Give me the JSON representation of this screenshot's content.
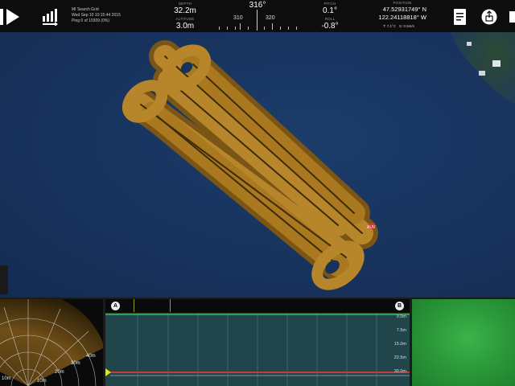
{
  "mission": {
    "name": "MI Search Grid",
    "datetime": "Wed Sep 10 10:15:44 2015",
    "ping": "Ping 0 of 10309 (0%)"
  },
  "telemetry": {
    "depth_label": "DEPTH",
    "depth_value": "32.2m",
    "altitude_label": "ALTITUDE",
    "altitude_value": "3.0m",
    "heading_value": "316°",
    "heading_tick_a": "310",
    "heading_tick_b": "320",
    "pitch_label": "PITCH",
    "pitch_value": "0.1°",
    "roll_label": "ROLL",
    "roll_value": "-0.8°",
    "position_label": "POSITION",
    "lat": "47.52931749° N",
    "lon": "122.24118818° W",
    "temperature": "T: 7.1°C",
    "speed": "S: 0.5m/s"
  },
  "icons": {
    "play": "play-icon",
    "bars": "signal-bars-icon",
    "doc": "document-icon",
    "share": "share-icon",
    "export": "export-icon"
  },
  "fan": {
    "ranges": [
      "10m",
      "20m",
      "30m",
      "40m"
    ],
    "left_range": "10m"
  },
  "waterfall": {
    "marker_a": "A",
    "marker_b": "B",
    "depths": [
      "0.0m",
      "7.5m",
      "15.0m",
      "22.5m",
      "30.0m"
    ],
    "depth_line_value": 30.0
  },
  "colors": {
    "sonar": "#b8862a",
    "water": "#17325c",
    "depth_line": "#c53a3a",
    "camera": "#2b9a3a",
    "heading_marker": "#e6e600"
  }
}
